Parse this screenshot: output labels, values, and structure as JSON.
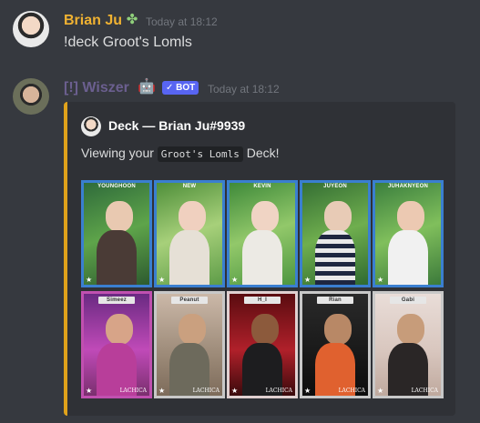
{
  "messages": [
    {
      "author": "Brian Ju",
      "timestamp": "Today at 18:12",
      "text": "!deck Groot's Lomls"
    },
    {
      "author": "[!] Wiszer",
      "bot_tag": "✓ BOT",
      "timestamp": "Today at 18:12",
      "embed": {
        "author": "Deck — Brian Ju#9939",
        "description_prefix": "Viewing your",
        "description_code": "Groot's Lomls",
        "description_suffix": "Deck!"
      }
    }
  ],
  "cards_row1": [
    "YOUNGHOON",
    "NEW",
    "KEVIN",
    "JUYEON",
    "JUHAKNYEON"
  ],
  "cards_row2": [
    "Simeez",
    "Peanut",
    "H_I",
    "Rian",
    "Gabi"
  ],
  "card_logo": "LACHICA",
  "colors": {
    "accent": "#e0a21b",
    "bot": "#5865f2",
    "name1": "#f0b232",
    "name2": "#6b5f8f",
    "row1_border": "#3a7fd0"
  }
}
